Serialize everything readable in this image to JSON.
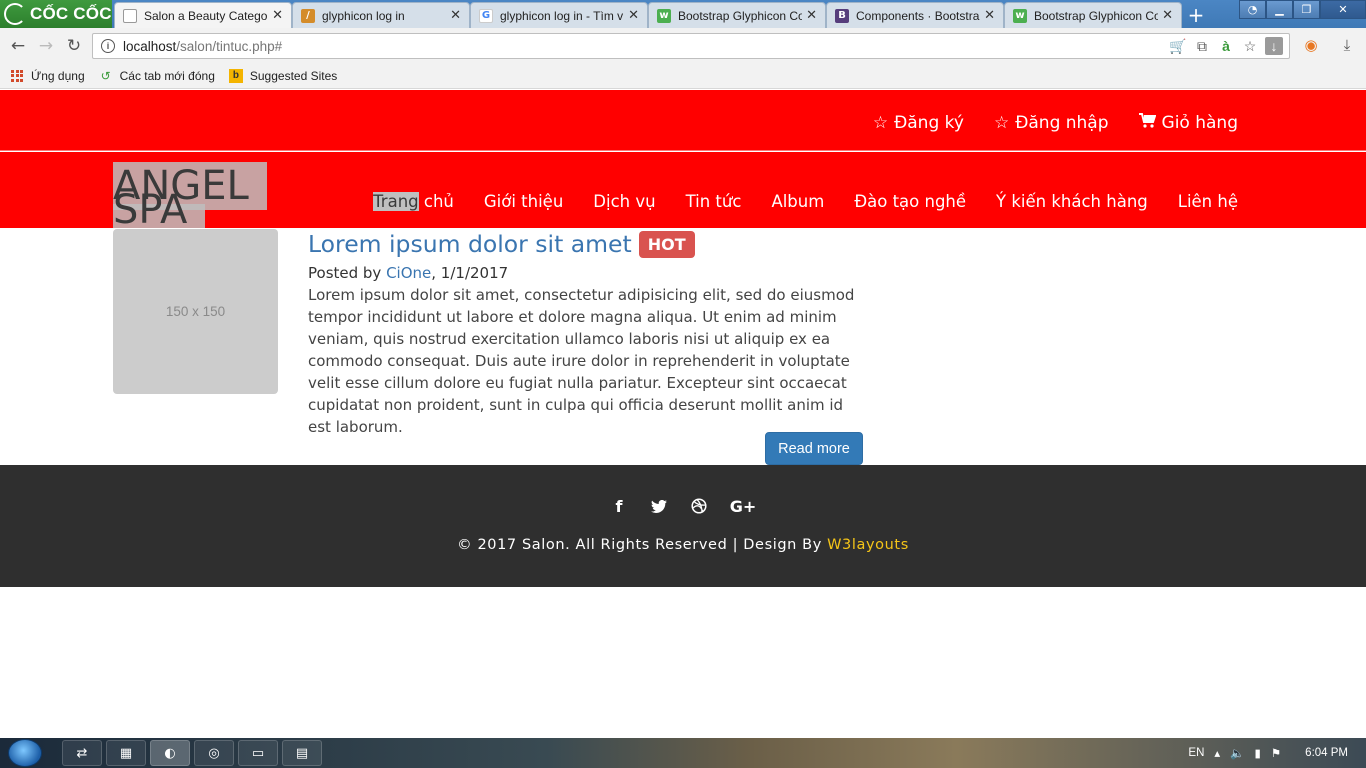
{
  "browser": {
    "brand": "CỐC CỐC",
    "tabs": [
      {
        "title": "Salon a Beauty Categor",
        "favicon": "page-icon",
        "active": true
      },
      {
        "title": "glyphicon log in",
        "favicon": "coccoc-icon",
        "active": false
      },
      {
        "title": "glyphicon log in - Tìm v",
        "favicon": "google-icon",
        "active": false
      },
      {
        "title": "Bootstrap Glyphicon Co",
        "favicon": "w3schools-icon",
        "active": false
      },
      {
        "title": "Components · Bootstrap",
        "favicon": "bootstrap-icon",
        "active": false
      },
      {
        "title": "Bootstrap Glyphicon Co",
        "favicon": "w3schools-icon",
        "active": false
      }
    ],
    "url_host": "localhost",
    "url_path": "/salon/tintuc.php#",
    "bookmarks": [
      "Ứng dụng",
      "Các tab mới đóng",
      "Suggested Sites"
    ]
  },
  "site": {
    "top_links": [
      {
        "icon": "star-icon",
        "label": "Đăng ký"
      },
      {
        "icon": "star-icon",
        "label": "Đăng nhập"
      },
      {
        "icon": "cart-icon",
        "label": "Giỏ hàng"
      }
    ],
    "logo_line1": "ANGEL",
    "logo_line2": "SPA",
    "menu": {
      "home_selected": "Trang",
      "home_rest": " chủ",
      "items": [
        "Giới thiệu",
        "Dịch vụ",
        "Tin tức",
        "Album",
        "Đào tạo nghề",
        "Ý kiến khách hàng",
        "Liên hệ"
      ]
    },
    "post": {
      "thumb_text": "150 x 150",
      "title": "Lorem ipsum dolor sit amet",
      "badge": "HOT",
      "posted_by": "Posted by ",
      "author": "CiOne",
      "date": ", 1/1/2017",
      "body": "Lorem ipsum dolor sit amet, consectetur adipisicing elit, sed do eiusmod tempor incididunt ut labore et dolore magna aliqua. Ut enim ad minim veniam, quis nostrud exercitation ullamco laboris nisi ut aliquip ex ea commodo consequat. Duis aute irure dolor in reprehenderit in voluptate velit esse cillum dolore eu fugiat nulla pariatur. Excepteur sint occaecat cupidatat non proident, sunt in culpa qui officia deserunt mollit anim id est laborum.",
      "read_more": "Read more"
    },
    "footer": {
      "social": [
        "facebook-icon",
        "twitter-icon",
        "dribbble-icon",
        "google-plus-icon"
      ],
      "copyright": "© 2017 Salon. All Rights Reserved | Design By ",
      "designer": "W3layouts"
    }
  },
  "taskbar": {
    "lang": "EN",
    "time": "6:04 PM"
  },
  "colors": {
    "site_red": "#ff0000",
    "link_blue": "#3a75b0",
    "badge_red": "#d9534f",
    "footer_bg": "#2f2f2f",
    "designer_yellow": "#f5c518"
  }
}
